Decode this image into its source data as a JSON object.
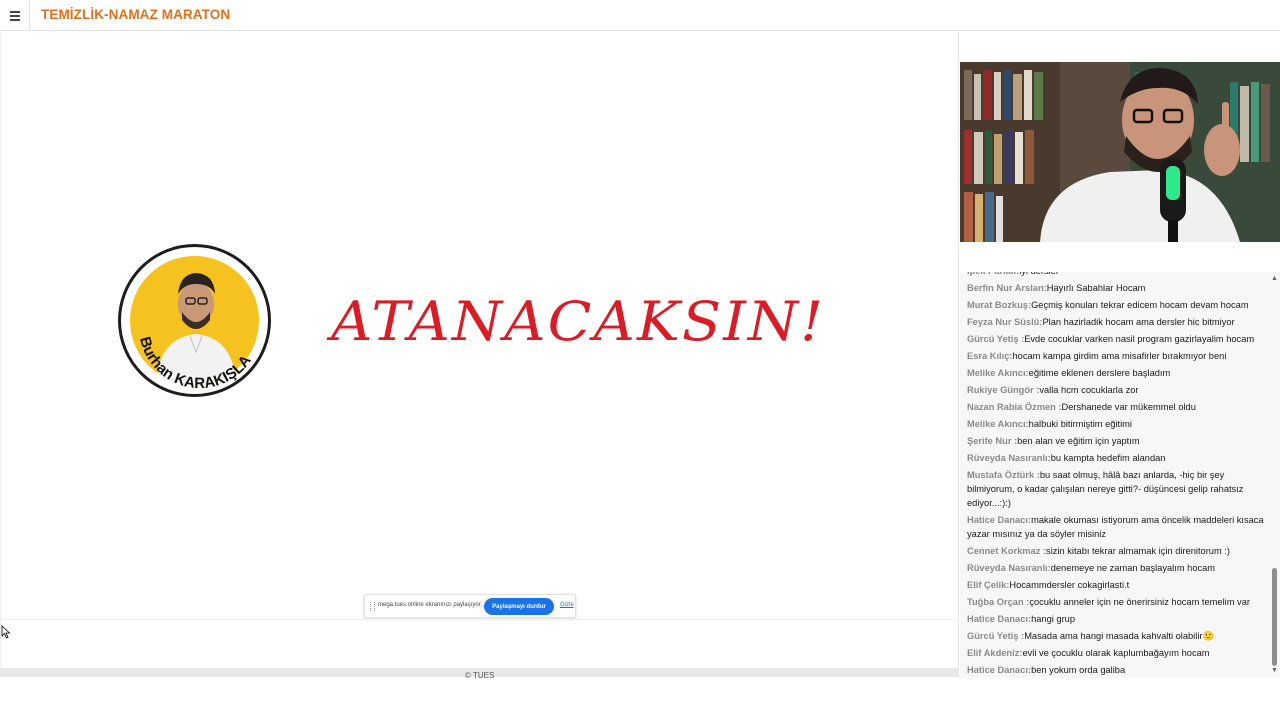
{
  "header": {
    "title": "TEMİZLİK-NAMAZ MARATON",
    "menu_icon": "hamburger-icon",
    "accent_color": "#e0701c"
  },
  "slide": {
    "logo_name": "Burhan KARAKIŞLA",
    "headline": "ATANACAKSIN!",
    "headline_color": "#d91d26"
  },
  "share_bar": {
    "message": "mega.tues.online ekranınızı paylaşıyor.",
    "stop_label": "Paylaşmayı durdur",
    "hide_label": "Gizle"
  },
  "footer": {
    "text": "© TUES"
  },
  "chat": {
    "messages": [
      {
        "name": "Ipek Parlak:",
        "text": "iyi dersler"
      },
      {
        "name": "Berfin Nur Arslan:",
        "text": "Hayırlı Sabahlar Hocam"
      },
      {
        "name": "Murat Bozkuş:",
        "text": "Geçmiş konuları tekrar edicem hocam devam hocam"
      },
      {
        "name": "Feyza Nur Süslü:",
        "text": "Plan hazirladik hocam ama dersler hic bitmiyor"
      },
      {
        "name": "Gürcü Yetiş :",
        "text": "Evde cocuklar varken nasil program gazirlayalim hocam"
      },
      {
        "name": "Esra Kılıç:",
        "text": "hocam kampa girdim ama misafirler bırakmıyor beni"
      },
      {
        "name": "Melike Akıncı:",
        "text": "eğitime eklenen derslere başladım"
      },
      {
        "name": "Rukiye Güngör :",
        "text": "valla hcm cocuklarla zor"
      },
      {
        "name": "Nazan Rabia Özmen :",
        "text": "Dershanede var mükemmel oldu"
      },
      {
        "name": "Melike Akıncı:",
        "text": "halbuki bitirmiştim eğitimi"
      },
      {
        "name": "Şerife Nur :",
        "text": "ben alan ve eğitim için yaptım"
      },
      {
        "name": "Rüveyda Nasıranlı:",
        "text": "bu kampta hedefim alandan"
      },
      {
        "name": "Mustafa Öztürk :",
        "text": "bu saat olmuş, hâlâ bazı anlarda, -hiç bir şey bilmiyorum, o kadar çalışılan nereye gitti?- düşüncesi gelip rahatsız ediyor...:):)"
      },
      {
        "name": "Hatice Danacı:",
        "text": "makale okuması istiyorum ama öncelik maddeleri kısaca yazar mısınız ya da söyler misiniz"
      },
      {
        "name": "Cennet Korkmaz :",
        "text": "sizin kitabı tekrar almamak için direnitorum :)"
      },
      {
        "name": "Rüveyda Nasıranlı:",
        "text": "denemeye ne zaman başlayalım hocam"
      },
      {
        "name": "Elif Çelik:",
        "text": "Hocammdersler cokagirlasti.t"
      },
      {
        "name": "Tuğba Orçan :",
        "text": "çocuklu anneler için ne önerirsiniz hocam temelim var"
      },
      {
        "name": "Hatice Danacı:",
        "text": "hangi grup"
      },
      {
        "name": "Gürcü Yetiş :",
        "text": "Masada ama hangi masada kahvalti olabilir🙂"
      },
      {
        "name": "Elif Akdeniz:",
        "text": "evli ve çocuklu olarak kaplumbağayım hocam"
      },
      {
        "name": "Hatice Danacı:",
        "text": "ben yokum orda galiba"
      }
    ]
  }
}
